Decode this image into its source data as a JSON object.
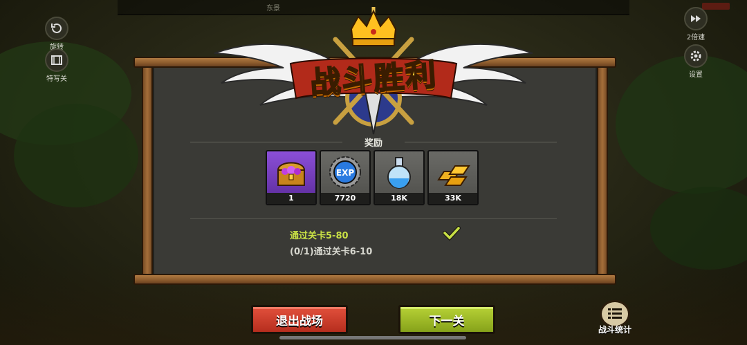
{
  "topbar": {
    "left_text": "东景"
  },
  "hud_left": [
    {
      "label": "旋转",
      "icon": "rotate-icon"
    },
    {
      "label": "特写关",
      "icon": "film-icon"
    }
  ],
  "hud_right": [
    {
      "label": "2倍速",
      "icon": "fast-forward-icon"
    },
    {
      "label": "设置",
      "icon": "gear-icon"
    }
  ],
  "title": "战斗胜利",
  "rewards_label": "奖励",
  "rewards": [
    {
      "item": "treasure-chest",
      "count": "1",
      "color": "#8b4fd8"
    },
    {
      "item": "exp-token",
      "count": "7720",
      "color": "#6a6a66"
    },
    {
      "item": "potion-flask",
      "count": "18K",
      "color": "#6a6a66"
    },
    {
      "item": "gold-bars",
      "count": "33K",
      "color": "#6a6a66"
    }
  ],
  "quests": [
    {
      "text": "通过关卡5-80",
      "completed": true
    },
    {
      "text": "(0/1)通过关卡6-10",
      "completed": false
    }
  ],
  "buttons": {
    "exit": "退出战场",
    "next": "下一关",
    "stats": "战斗统计"
  },
  "colors": {
    "title_gold": "#ffd93a",
    "quest_done": "#c8e045",
    "exit_red": "#c83a28",
    "next_green": "#9cba28"
  }
}
